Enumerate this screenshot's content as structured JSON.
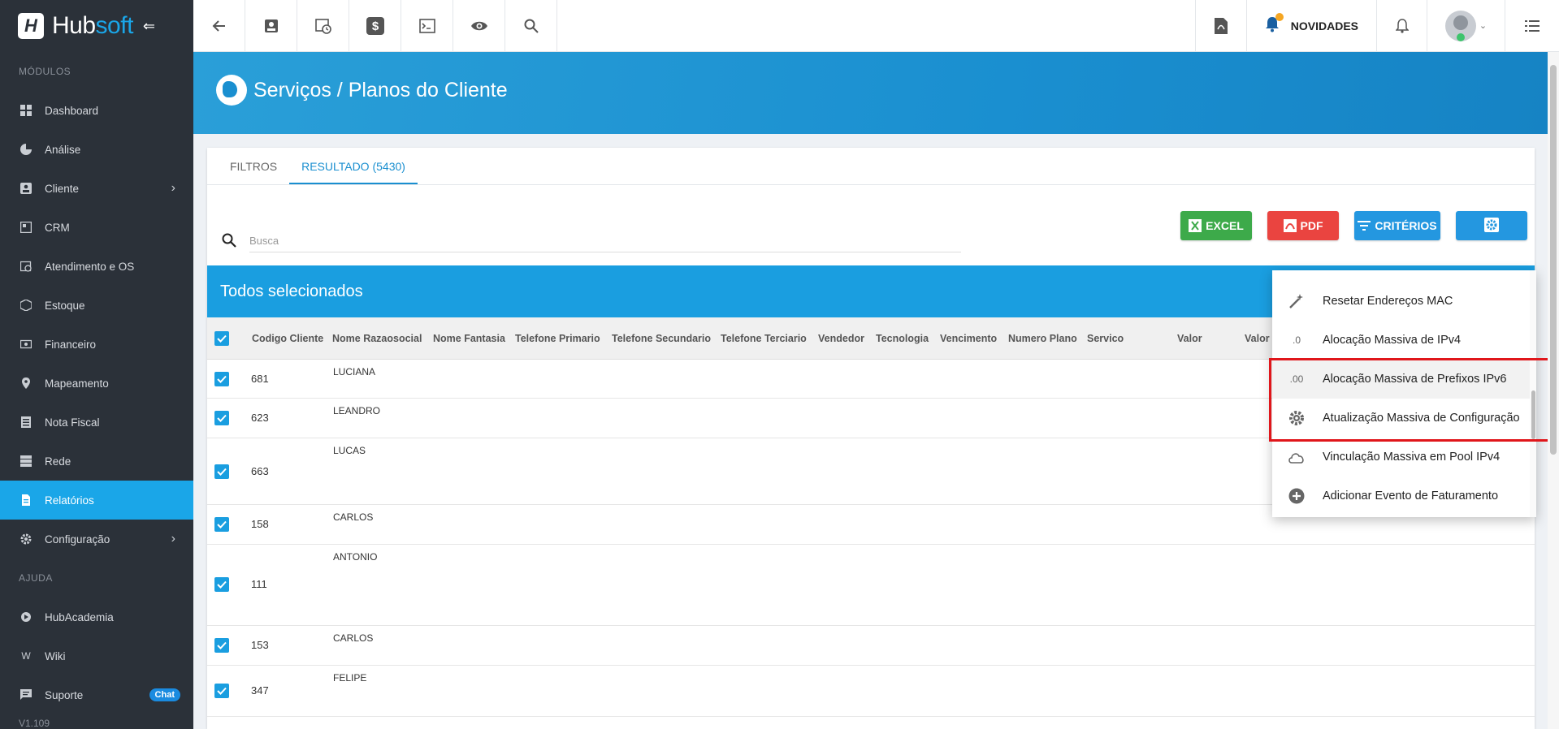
{
  "app": {
    "brand_first": "Hub",
    "brand_second": "soft",
    "collapse_glyph": "⇐",
    "version": "V1.109"
  },
  "colors": {
    "accent": "#1aa6e8",
    "sidebar_bg": "#2b3139",
    "excel": "#3daa4a",
    "pdf": "#ea4440",
    "primary": "#2497e0",
    "highlight_border": "#e0161b"
  },
  "sidebar": {
    "section_modules": "MÓDULOS",
    "section_help": "AJUDA",
    "items": [
      {
        "label": "Dashboard",
        "icon": "grid-icon"
      },
      {
        "label": "Análise",
        "icon": "pie-chart-icon"
      },
      {
        "label": "Cliente",
        "icon": "contact-icon",
        "has_children": true
      },
      {
        "label": "CRM",
        "icon": "crm-icon"
      },
      {
        "label": "Atendimento e OS",
        "icon": "calendar-clock-icon"
      },
      {
        "label": "Estoque",
        "icon": "box-icon"
      },
      {
        "label": "Financeiro",
        "icon": "money-icon"
      },
      {
        "label": "Mapeamento",
        "icon": "map-pin-icon"
      },
      {
        "label": "Nota Fiscal",
        "icon": "receipt-icon"
      },
      {
        "label": "Rede",
        "icon": "server-icon"
      },
      {
        "label": "Relatórios",
        "icon": "document-icon",
        "active": true
      },
      {
        "label": "Configuração",
        "icon": "gear-icon",
        "has_children": true
      }
    ],
    "help_items": [
      {
        "label": "HubAcademia",
        "icon": "academia-icon"
      },
      {
        "label": "Wiki",
        "icon": "wiki-icon"
      },
      {
        "label": "Suporte",
        "icon": "chat-icon",
        "badge": "Chat"
      }
    ]
  },
  "topbar": {
    "novidades_label": "NOVIDADES"
  },
  "header": {
    "title": "Serviços / Planos do Cliente"
  },
  "tabs": [
    {
      "label": "FILTROS",
      "active": false
    },
    {
      "label": "RESULTADO (5430)",
      "active": true
    }
  ],
  "search": {
    "placeholder": "Busca",
    "value": ""
  },
  "buttons": {
    "excel": "EXCEL",
    "pdf": "PDF",
    "criterios": "CRITÉRIOS"
  },
  "selection_bar": "Todos selecionados",
  "table": {
    "columns": [
      "Codigo Cliente",
      "Nome Razaosocial",
      "Nome Fantasia",
      "Telefone Primario",
      "Telefone Secundario",
      "Telefone Terciario",
      "Vendedor",
      "Tecnologia",
      "Vencimento",
      "Numero Plano",
      "Servico",
      "Valor",
      "Valor"
    ],
    "rows": [
      {
        "code": "681",
        "name": "LUCIANA"
      },
      {
        "code": "623",
        "name": "LEANDRO"
      },
      {
        "code": "663",
        "name": "LUCAS"
      },
      {
        "code": "158",
        "name": "CARLOS"
      },
      {
        "code": "111",
        "name": "ANTONIO"
      },
      {
        "code": "153",
        "name": "CARLOS"
      },
      {
        "code": "347",
        "name": "FELIPE"
      }
    ]
  },
  "dropdown": {
    "items": [
      {
        "label": "Resetar Endereços MAC",
        "icon": "magic-wand-icon"
      },
      {
        "label": "Alocação Massiva de IPv4",
        "icon": "ipv4-icon",
        "icon_text": ".0"
      },
      {
        "label": "Alocação Massiva de Prefixos IPv6",
        "icon": "ipv6-icon",
        "icon_text": ".00",
        "hover": true
      },
      {
        "label": "Atualização Massiva de Configuração",
        "icon": "gear-icon"
      },
      {
        "label": "Vinculação Massiva em Pool IPv4",
        "icon": "cloud-icon"
      },
      {
        "label": "Adicionar Evento de Faturamento",
        "icon": "add-circle-icon"
      }
    ]
  }
}
